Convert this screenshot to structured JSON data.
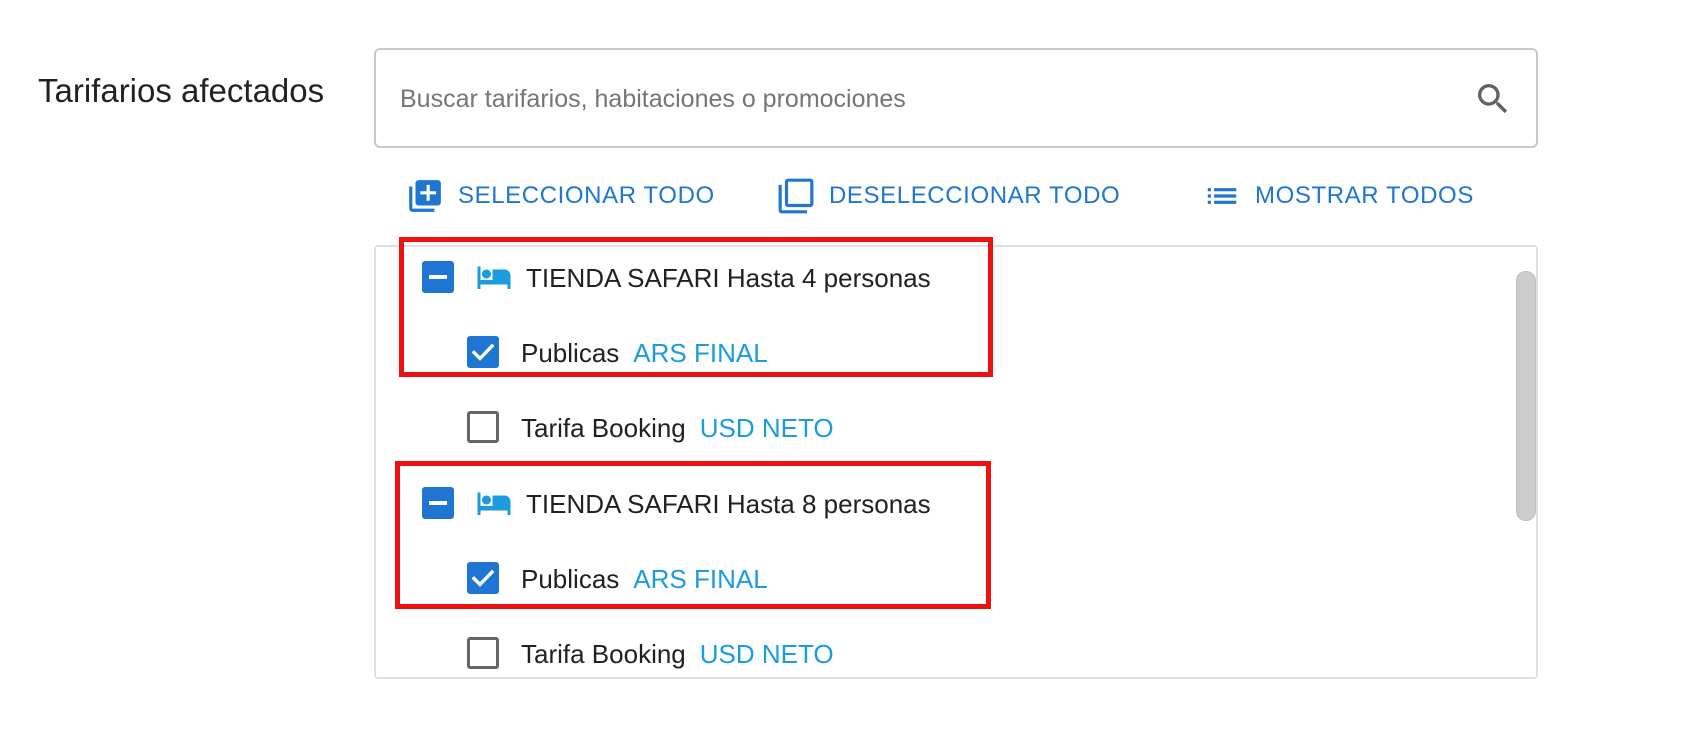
{
  "field": {
    "label": "Tarifarios afectados"
  },
  "search": {
    "placeholder": "Buscar tarifarios, habitaciones o promociones",
    "value": "",
    "icon": "search-icon"
  },
  "actions": {
    "select_all": "SELECCIONAR TODO",
    "deselect_all": "DESELECCIONAR TODO",
    "show_all": "MOSTRAR TODOS"
  },
  "rooms": [
    {
      "name": "TIENDA SAFARI Hasta 4 personas",
      "state": "indeterminate",
      "icon": "bed-icon",
      "rates": [
        {
          "name": "Publicas",
          "tag": "ARS FINAL",
          "checked": true
        },
        {
          "name": "Tarifa Booking",
          "tag": "USD NETO",
          "checked": false
        }
      ]
    },
    {
      "name": "TIENDA SAFARI Hasta 8 personas",
      "state": "indeterminate",
      "icon": "bed-icon",
      "rates": [
        {
          "name": "Publicas",
          "tag": "ARS FINAL",
          "checked": true
        },
        {
          "name": "Tarifa Booking",
          "tag": "USD NETO",
          "checked": false
        }
      ]
    }
  ],
  "colors": {
    "accent": "#1e76d2",
    "tag": "#1b9be0",
    "highlight": "#ee1111"
  }
}
